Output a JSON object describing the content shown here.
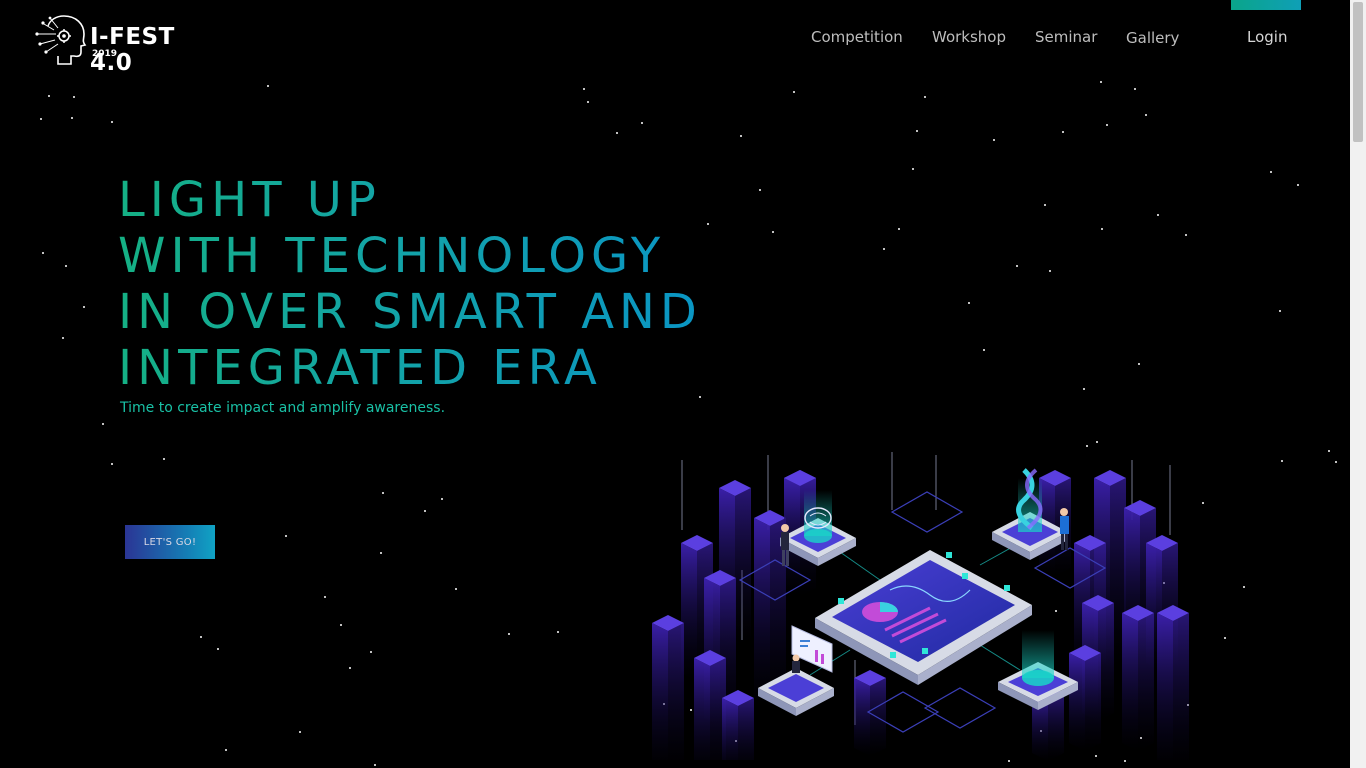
{
  "header": {
    "logo_title": "I-FEST 4.0",
    "logo_year": "2019",
    "nav": [
      "Competition",
      "Workshop",
      "Seminar",
      "Gallery"
    ],
    "login_label": "Login"
  },
  "hero": {
    "title_lines": [
      "LIGHT UP",
      "WITH TECHNOLOGY",
      "IN OVER SMART AND",
      "INTEGRATED ERA"
    ],
    "subtitle": "Time to create impact and amplify awareness.",
    "cta_label": "LET'S GO!"
  },
  "colors": {
    "background": "#000000",
    "accent_green": "#15b084",
    "accent_blue": "#0a95c4",
    "button_start": "#2b3595",
    "button_end": "#10a3c4"
  },
  "icons": [
    "brain-circuit-logo-icon",
    "isometric-smart-city-illustration"
  ]
}
